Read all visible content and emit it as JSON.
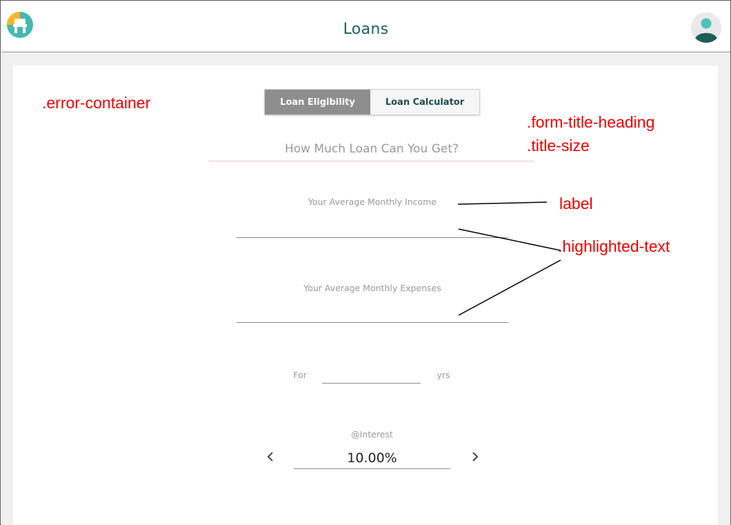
{
  "header": {
    "title": "Loans",
    "logo_icon": "loan-app-logo-icon",
    "avatar_icon": "user-avatar-icon"
  },
  "tabs": [
    {
      "label": "Loan Eligibility",
      "active": true
    },
    {
      "label": "Loan Calculator",
      "active": false
    }
  ],
  "form": {
    "heading": "How Much Loan Can You Get?",
    "income_label": "Your Average Monthly Income",
    "income_value": "",
    "expenses_label": "Your Average Monthly Expenses",
    "expenses_value": "",
    "tenure_prefix": "For",
    "tenure_value": "",
    "tenure_suffix": "yrs",
    "interest_label": "@Interest",
    "interest_value": "10.00%",
    "decrease_icon": "chevron-left-icon",
    "increase_icon": "chevron-right-icon"
  },
  "annotations": {
    "error_container": ".error-container",
    "form_title_heading": ".form-title-heading",
    "title_size": ".title-size",
    "label": "label",
    "highlighted_text": ".highlighted-text"
  },
  "colors": {
    "annotation_red": "#f00000",
    "header_title": "#1f5f5f",
    "active_tab": "#8e8e8e",
    "logo_yellow": "#f7b52a",
    "logo_teal": "#45b8b0"
  }
}
